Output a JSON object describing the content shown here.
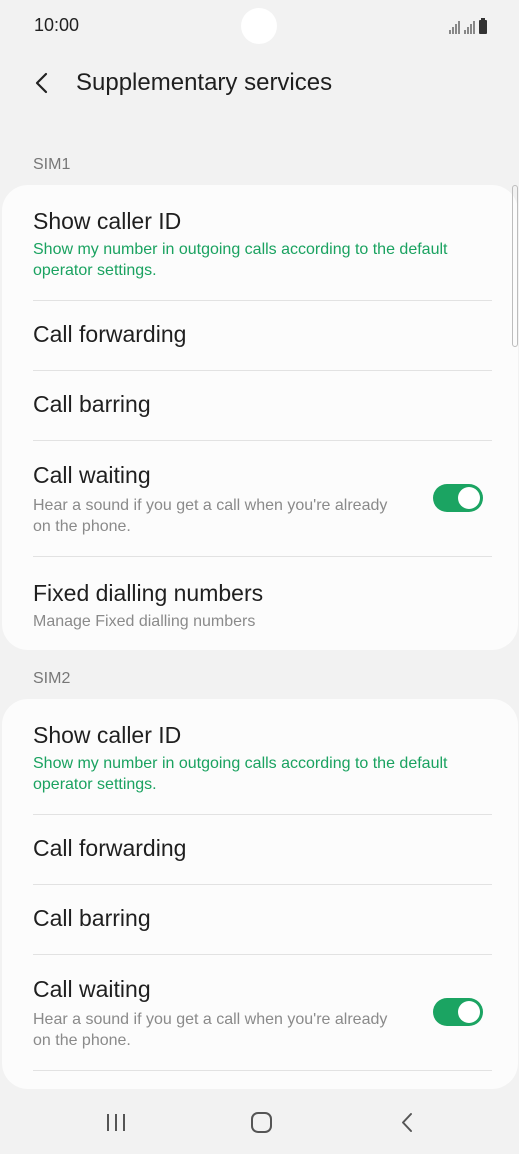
{
  "status_bar": {
    "time": "10:00",
    "icons": [
      "signal-sim1-icon",
      "signal-sim2-icon",
      "battery-icon"
    ]
  },
  "header": {
    "back_icon": "chevron-left-icon",
    "title": "Supplementary services"
  },
  "sections": [
    {
      "label": "SIM1",
      "items": [
        {
          "title": "Show caller ID",
          "subtitle": "Show my number in outgoing calls according to the default operator settings."
        },
        {
          "title": "Call forwarding"
        },
        {
          "title": "Call barring"
        },
        {
          "title": "Call waiting",
          "subtitle": "Hear a sound if you get a call when you're already on the phone.",
          "toggle": true
        },
        {
          "title": "Fixed dialling numbers",
          "subtitle": "Manage Fixed dialling numbers"
        }
      ]
    },
    {
      "label": "SIM2",
      "items": [
        {
          "title": "Show caller ID",
          "subtitle": "Show my number in outgoing calls according to the default operator settings."
        },
        {
          "title": "Call forwarding"
        },
        {
          "title": "Call barring"
        },
        {
          "title": "Call waiting",
          "subtitle": "Hear a sound if you get a call when you're already on the phone.",
          "toggle": true
        }
      ]
    }
  ],
  "colors": {
    "accent": "#1ba462",
    "subtitle_green": "#1aa260",
    "background": "#f2f2f2",
    "card": "#fcfcfc"
  },
  "nav_bar": {
    "icons": [
      "recent-apps-icon",
      "home-icon",
      "back-icon"
    ]
  }
}
